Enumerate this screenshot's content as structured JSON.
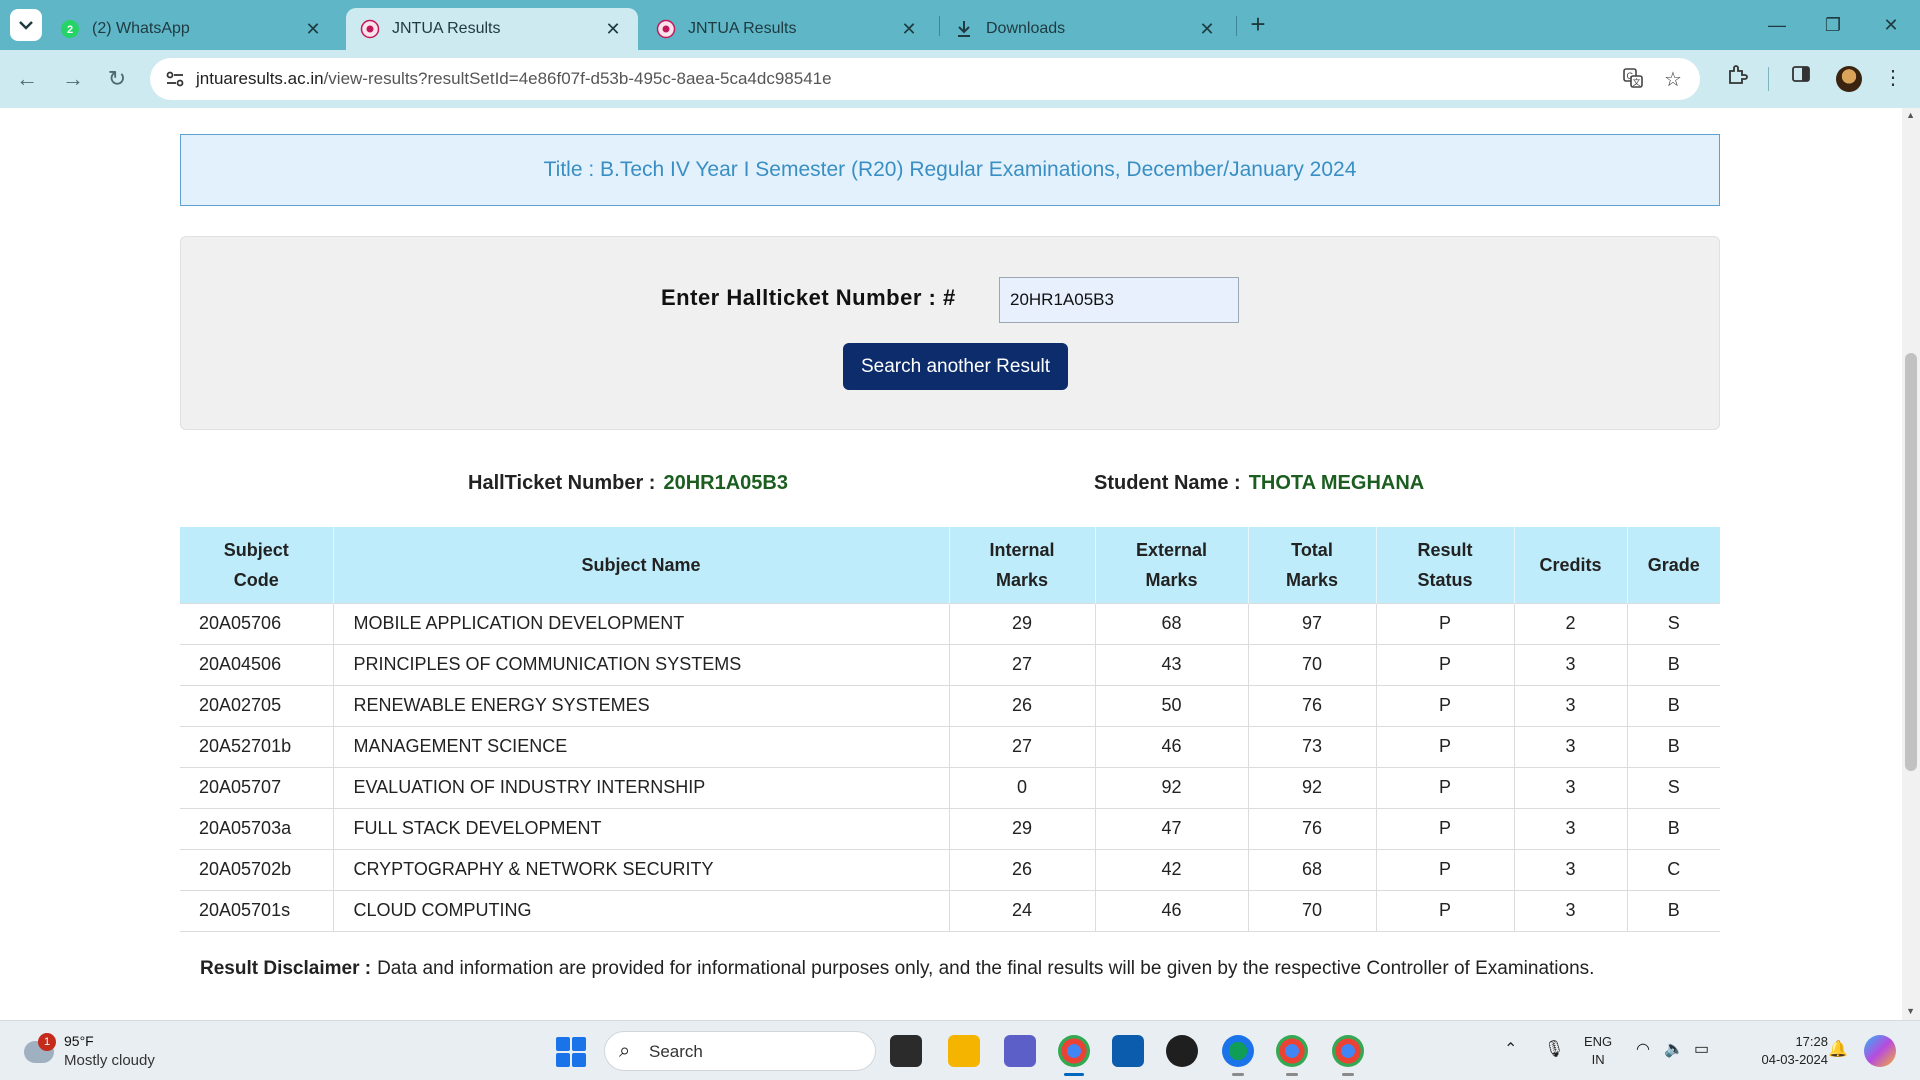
{
  "browser": {
    "tabs": [
      {
        "title": "(2) WhatsApp",
        "icon": "whatsapp-icon",
        "active": false
      },
      {
        "title": "JNTUA Results",
        "icon": "jntua-logo-icon",
        "active": true
      },
      {
        "title": "JNTUA Results",
        "icon": "jntua-logo-icon",
        "active": false
      },
      {
        "title": "Downloads",
        "icon": "download-icon",
        "active": false
      }
    ],
    "url_domain": "jntuaresults.ac.in",
    "url_path": "/view-results?resultSetId=4e86f07f-d53b-495c-8aea-5ca4dc98541e",
    "tab_bar_color": "#5fb6c6",
    "toolbar_color": "#cdeaf0"
  },
  "page": {
    "title": "Title : B.Tech IV Year I Semester (R20) Regular Examinations, December/January 2024",
    "search": {
      "label": "Enter Hallticket Number : #",
      "value": "20HR1A05B3",
      "button_label": "Search another Result"
    },
    "student": {
      "hallticket_label": "HallTicket Number :",
      "hallticket_value": "20HR1A05B3",
      "name_label": "Student Name :",
      "name_value": "THOTA MEGHANA"
    },
    "table": {
      "headers": {
        "code_l1": "Subject",
        "code_l2": "Code",
        "name": "Subject Name",
        "internal_l1": "Internal",
        "internal_l2": "Marks",
        "external_l1": "External",
        "external_l2": "Marks",
        "total_l1": "Total",
        "total_l2": "Marks",
        "status_l1": "Result",
        "status_l2": "Status",
        "credits": "Credits",
        "grade": "Grade"
      },
      "rows": [
        {
          "code": "20A05706",
          "name": "MOBILE APPLICATION DEVELOPMENT",
          "internal": "29",
          "external": "68",
          "total": "97",
          "status": "P",
          "credits": "2",
          "grade": "S"
        },
        {
          "code": "20A04506",
          "name": "PRINCIPLES OF COMMUNICATION SYSTEMS",
          "internal": "27",
          "external": "43",
          "total": "70",
          "status": "P",
          "credits": "3",
          "grade": "B"
        },
        {
          "code": "20A02705",
          "name": "RENEWABLE ENERGY SYSTEMES",
          "internal": "26",
          "external": "50",
          "total": "76",
          "status": "P",
          "credits": "3",
          "grade": "B"
        },
        {
          "code": "20A52701b",
          "name": "MANAGEMENT SCIENCE",
          "internal": "27",
          "external": "46",
          "total": "73",
          "status": "P",
          "credits": "3",
          "grade": "B"
        },
        {
          "code": "20A05707",
          "name": "EVALUATION OF INDUSTRY INTERNSHIP",
          "internal": "0",
          "external": "92",
          "total": "92",
          "status": "P",
          "credits": "3",
          "grade": "S"
        },
        {
          "code": "20A05703a",
          "name": "FULL STACK DEVELOPMENT",
          "internal": "29",
          "external": "47",
          "total": "76",
          "status": "P",
          "credits": "3",
          "grade": "B"
        },
        {
          "code": "20A05702b",
          "name": "CRYPTOGRAPHY & NETWORK SECURITY",
          "internal": "26",
          "external": "42",
          "total": "68",
          "status": "P",
          "credits": "3",
          "grade": "C"
        },
        {
          "code": "20A05701s",
          "name": "CLOUD COMPUTING",
          "internal": "24",
          "external": "46",
          "total": "70",
          "status": "P",
          "credits": "3",
          "grade": "B"
        }
      ]
    },
    "disclaimer": {
      "label": "Result Disclaimer :",
      "text": "Data and information are provided for informational purposes only, and the final results will be given by the respective Controller of Examinations."
    },
    "colors": {
      "title_bg": "#e3f1fd",
      "title_text": "#3a8fc2",
      "button_bg": "#0d2c6b",
      "header_bg": "#bfecfa",
      "highlight_value": "#1b5e20"
    }
  },
  "taskbar": {
    "weather_temp": "95°F",
    "weather_desc": "Mostly cloudy",
    "weather_badge": "1",
    "search_placeholder": "Search",
    "lang_line1": "ENG",
    "lang_line2": "IN",
    "time": "17:28",
    "date": "04-03-2024"
  }
}
